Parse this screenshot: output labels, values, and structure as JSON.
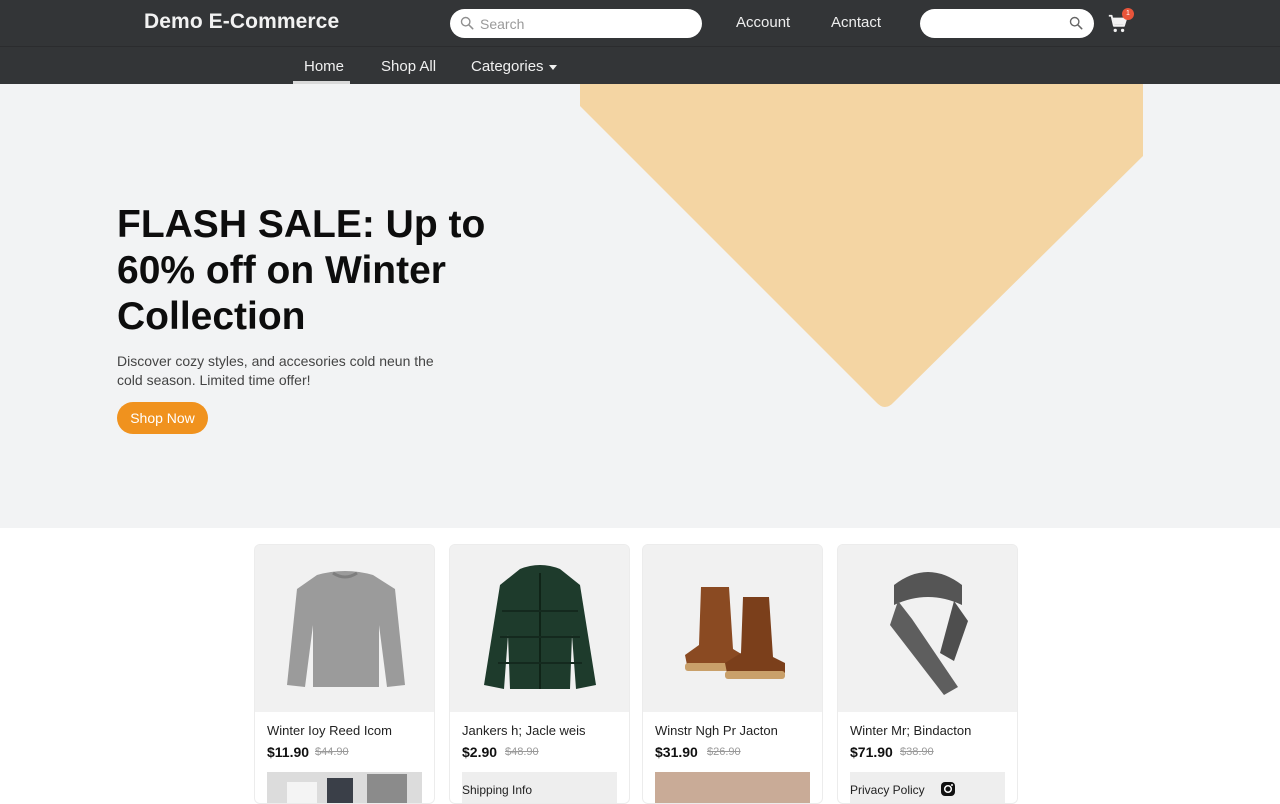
{
  "header": {
    "brand": "Demo E-Commerce",
    "search_placeholder": "Search",
    "links": [
      "Account",
      "Acntact"
    ],
    "cart_count": "1"
  },
  "nav": {
    "items": [
      "Home",
      "Shop All",
      "Categories"
    ],
    "active": "Home"
  },
  "hero": {
    "title": "FLASH SALE: Up to 60% off on Winter Collection",
    "subtitle": "Discover cozy styles, and acceѕories cold neun the cold season. Limited time offer!",
    "cta": "Shop Now",
    "accent_color": "#f4d5a3"
  },
  "products": [
    {
      "name": "Winter Ioy Reed Icom",
      "price": "$11.90",
      "old_price": "$44.90",
      "image": "sweater-icon",
      "footer": ""
    },
    {
      "name": "Jankers h; Jacle weis",
      "price": "$2.90",
      "old_price": "$48.90",
      "image": "puffer-jacket-icon",
      "footer": "Shipping Info"
    },
    {
      "name": "Winstr Ngh Pr Jacton",
      "price": "$31.90",
      "old_price": "$26.90",
      "image": "boots-icon",
      "footer": ""
    },
    {
      "name": "Winter Mr; Bindacton",
      "price": "$71.90",
      "old_price": "$38.90",
      "image": "scarf-icon",
      "footer": "Privacy Policy"
    }
  ],
  "colors": {
    "header_bg": "#333537",
    "cta": "#f0921e",
    "badge": "#e8543a"
  }
}
